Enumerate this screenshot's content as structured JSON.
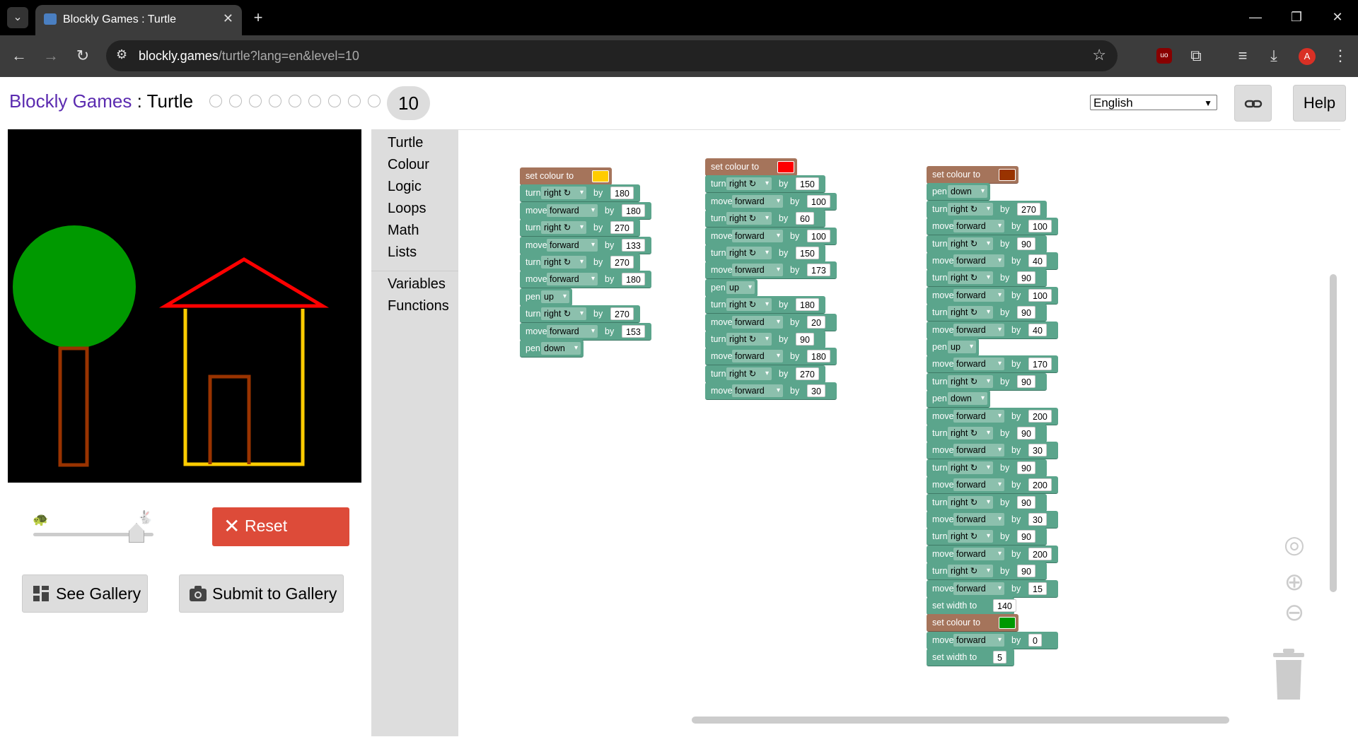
{
  "browser": {
    "tab_title": "Blockly Games : Turtle",
    "new_tab": "+",
    "url_host": "blockly.games",
    "url_path": "/turtle?lang=en&level=10",
    "profile_initial": "A",
    "ext_badge": "uo",
    "window_controls": [
      "—",
      "❐",
      "✕"
    ]
  },
  "header": {
    "brand": "Blockly Games",
    "separator": " : ",
    "game": "Turtle",
    "level_count": 9,
    "current_level": "10",
    "language": "English",
    "help": "Help"
  },
  "controls": {
    "reset": "Reset",
    "see_gallery": "See Gallery",
    "submit_gallery": "Submit to Gallery",
    "speed": 0.9
  },
  "toolbox": {
    "group1": [
      "Turtle",
      "Colour",
      "Logic",
      "Loops",
      "Math",
      "Lists"
    ],
    "group2": [
      "Variables",
      "Functions"
    ]
  },
  "programs": [
    {
      "colour": "#ffcc00",
      "blocks": [
        {
          "type": "set_colour",
          "label": "set colour to"
        },
        {
          "type": "turn",
          "kw": "turn",
          "opt": "right ↻",
          "by": "by",
          "val": "180"
        },
        {
          "type": "move",
          "kw": "move",
          "opt": "forward",
          "by": "by",
          "val": "180"
        },
        {
          "type": "turn",
          "kw": "turn",
          "opt": "right ↻",
          "by": "by",
          "val": "270"
        },
        {
          "type": "move",
          "kw": "move",
          "opt": "forward",
          "by": "by",
          "val": "133"
        },
        {
          "type": "turn",
          "kw": "turn",
          "opt": "right ↻",
          "by": "by",
          "val": "270"
        },
        {
          "type": "move",
          "kw": "move",
          "opt": "forward",
          "by": "by",
          "val": "180"
        },
        {
          "type": "pen",
          "kw": "pen",
          "opt": "up"
        },
        {
          "type": "turn",
          "kw": "turn",
          "opt": "right ↻",
          "by": "by",
          "val": "270"
        },
        {
          "type": "move",
          "kw": "move",
          "opt": "forward",
          "by": "by",
          "val": "153"
        },
        {
          "type": "pen",
          "kw": "pen",
          "opt": "down"
        }
      ]
    },
    {
      "colour": "#ff0000",
      "blocks": [
        {
          "type": "set_colour",
          "label": "set colour to"
        },
        {
          "type": "turn",
          "kw": "turn",
          "opt": "right ↻",
          "by": "by",
          "val": "150"
        },
        {
          "type": "move",
          "kw": "move",
          "opt": "forward",
          "by": "by",
          "val": "100"
        },
        {
          "type": "turn",
          "kw": "turn",
          "opt": "right ↻",
          "by": "by",
          "val": "60"
        },
        {
          "type": "move",
          "kw": "move",
          "opt": "forward",
          "by": "by",
          "val": "100"
        },
        {
          "type": "turn",
          "kw": "turn",
          "opt": "right ↻",
          "by": "by",
          "val": "150"
        },
        {
          "type": "move",
          "kw": "move",
          "opt": "forward",
          "by": "by",
          "val": "173"
        },
        {
          "type": "pen",
          "kw": "pen",
          "opt": "up"
        },
        {
          "type": "turn",
          "kw": "turn",
          "opt": "right ↻",
          "by": "by",
          "val": "180"
        },
        {
          "type": "move",
          "kw": "move",
          "opt": "forward",
          "by": "by",
          "val": "20"
        },
        {
          "type": "turn",
          "kw": "turn",
          "opt": "right ↻",
          "by": "by",
          "val": "90"
        },
        {
          "type": "move",
          "kw": "move",
          "opt": "forward",
          "by": "by",
          "val": "180"
        },
        {
          "type": "turn",
          "kw": "turn",
          "opt": "right ↻",
          "by": "by",
          "val": "270"
        },
        {
          "type": "move",
          "kw": "move",
          "opt": "forward",
          "by": "by",
          "val": "30"
        }
      ]
    },
    {
      "colour": "#993300",
      "blocks": [
        {
          "type": "set_colour",
          "label": "set colour to"
        },
        {
          "type": "pen",
          "kw": "pen",
          "opt": "down"
        },
        {
          "type": "turn",
          "kw": "turn",
          "opt": "right ↻",
          "by": "by",
          "val": "270"
        },
        {
          "type": "move",
          "kw": "move",
          "opt": "forward",
          "by": "by",
          "val": "100"
        },
        {
          "type": "turn",
          "kw": "turn",
          "opt": "right ↻",
          "by": "by",
          "val": "90"
        },
        {
          "type": "move",
          "kw": "move",
          "opt": "forward",
          "by": "by",
          "val": "40"
        },
        {
          "type": "turn",
          "kw": "turn",
          "opt": "right ↻",
          "by": "by",
          "val": "90"
        },
        {
          "type": "move",
          "kw": "move",
          "opt": "forward",
          "by": "by",
          "val": "100"
        },
        {
          "type": "turn",
          "kw": "turn",
          "opt": "right ↻",
          "by": "by",
          "val": "90"
        },
        {
          "type": "move",
          "kw": "move",
          "opt": "forward",
          "by": "by",
          "val": "40"
        },
        {
          "type": "pen",
          "kw": "pen",
          "opt": "up"
        },
        {
          "type": "move",
          "kw": "move",
          "opt": "forward",
          "by": "by",
          "val": "170"
        },
        {
          "type": "turn",
          "kw": "turn",
          "opt": "right ↻",
          "by": "by",
          "val": "90"
        },
        {
          "type": "pen",
          "kw": "pen",
          "opt": "down"
        },
        {
          "type": "move",
          "kw": "move",
          "opt": "forward",
          "by": "by",
          "val": "200"
        },
        {
          "type": "turn",
          "kw": "turn",
          "opt": "right ↻",
          "by": "by",
          "val": "90"
        },
        {
          "type": "move",
          "kw": "move",
          "opt": "forward",
          "by": "by",
          "val": "30"
        },
        {
          "type": "turn",
          "kw": "turn",
          "opt": "right ↻",
          "by": "by",
          "val": "90"
        },
        {
          "type": "move",
          "kw": "move",
          "opt": "forward",
          "by": "by",
          "val": "200"
        },
        {
          "type": "turn",
          "kw": "turn",
          "opt": "right ↻",
          "by": "by",
          "val": "90"
        },
        {
          "type": "move",
          "kw": "move",
          "opt": "forward",
          "by": "by",
          "val": "30"
        },
        {
          "type": "turn",
          "kw": "turn",
          "opt": "right ↻",
          "by": "by",
          "val": "90"
        },
        {
          "type": "move",
          "kw": "move",
          "opt": "forward",
          "by": "by",
          "val": "200"
        },
        {
          "type": "turn",
          "kw": "turn",
          "opt": "right ↻",
          "by": "by",
          "val": "90"
        },
        {
          "type": "move",
          "kw": "move",
          "opt": "forward",
          "by": "by",
          "val": "15"
        },
        {
          "type": "width",
          "label": "set width to",
          "val": "140"
        },
        {
          "type": "set_colour",
          "label": "set colour to",
          "colour": "#009900"
        },
        {
          "type": "move",
          "kw": "move",
          "opt": "forward",
          "by": "by",
          "val": "0"
        },
        {
          "type": "width",
          "label": "set width to",
          "val": "5"
        }
      ]
    }
  ],
  "drawing": {
    "tree_crown": "#009900",
    "trunk": "#993300",
    "house": "#ffcc00",
    "roof": "#ff0000",
    "door": "#993300"
  }
}
